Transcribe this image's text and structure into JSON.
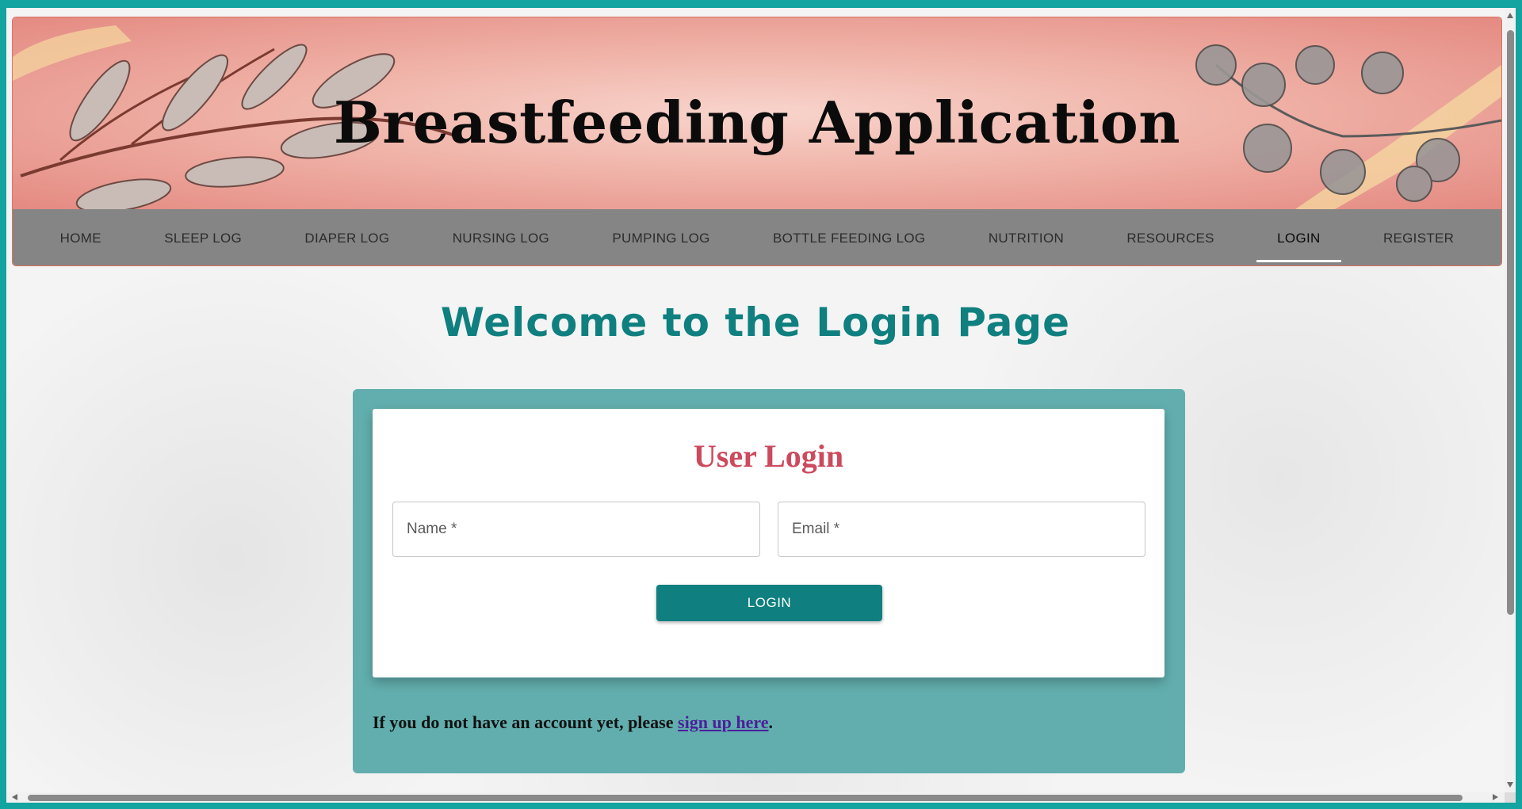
{
  "header": {
    "title": "Breastfeeding Application"
  },
  "nav": {
    "items": [
      {
        "label": "HOME"
      },
      {
        "label": "SLEEP LOG"
      },
      {
        "label": "DIAPER LOG"
      },
      {
        "label": "NURSING LOG"
      },
      {
        "label": "PUMPING LOG"
      },
      {
        "label": "BOTTLE FEEDING LOG"
      },
      {
        "label": "NUTRITION"
      },
      {
        "label": "RESOURCES"
      },
      {
        "label": "LOGIN"
      },
      {
        "label": "REGISTER"
      }
    ],
    "active": "LOGIN"
  },
  "main": {
    "page_title": "Welcome to the Login Page",
    "card_title": "User Login",
    "name_placeholder": "Name *",
    "email_placeholder": "Email *",
    "login_button": "LOGIN",
    "signup_prefix": "If you do not have an account yet, please ",
    "signup_link": "sign up here",
    "signup_suffix": "."
  },
  "colors": {
    "teal_accent": "#0f7f7f",
    "panel": "#62aeae",
    "card_title": "#cc4a5d",
    "nav_bar": "#858585",
    "outer_frame": "#13a3a0"
  },
  "icons": {
    "scroll_up": "scroll-up-icon",
    "scroll_down": "scroll-down-icon",
    "scroll_left": "scroll-left-icon",
    "scroll_right": "scroll-right-icon"
  }
}
